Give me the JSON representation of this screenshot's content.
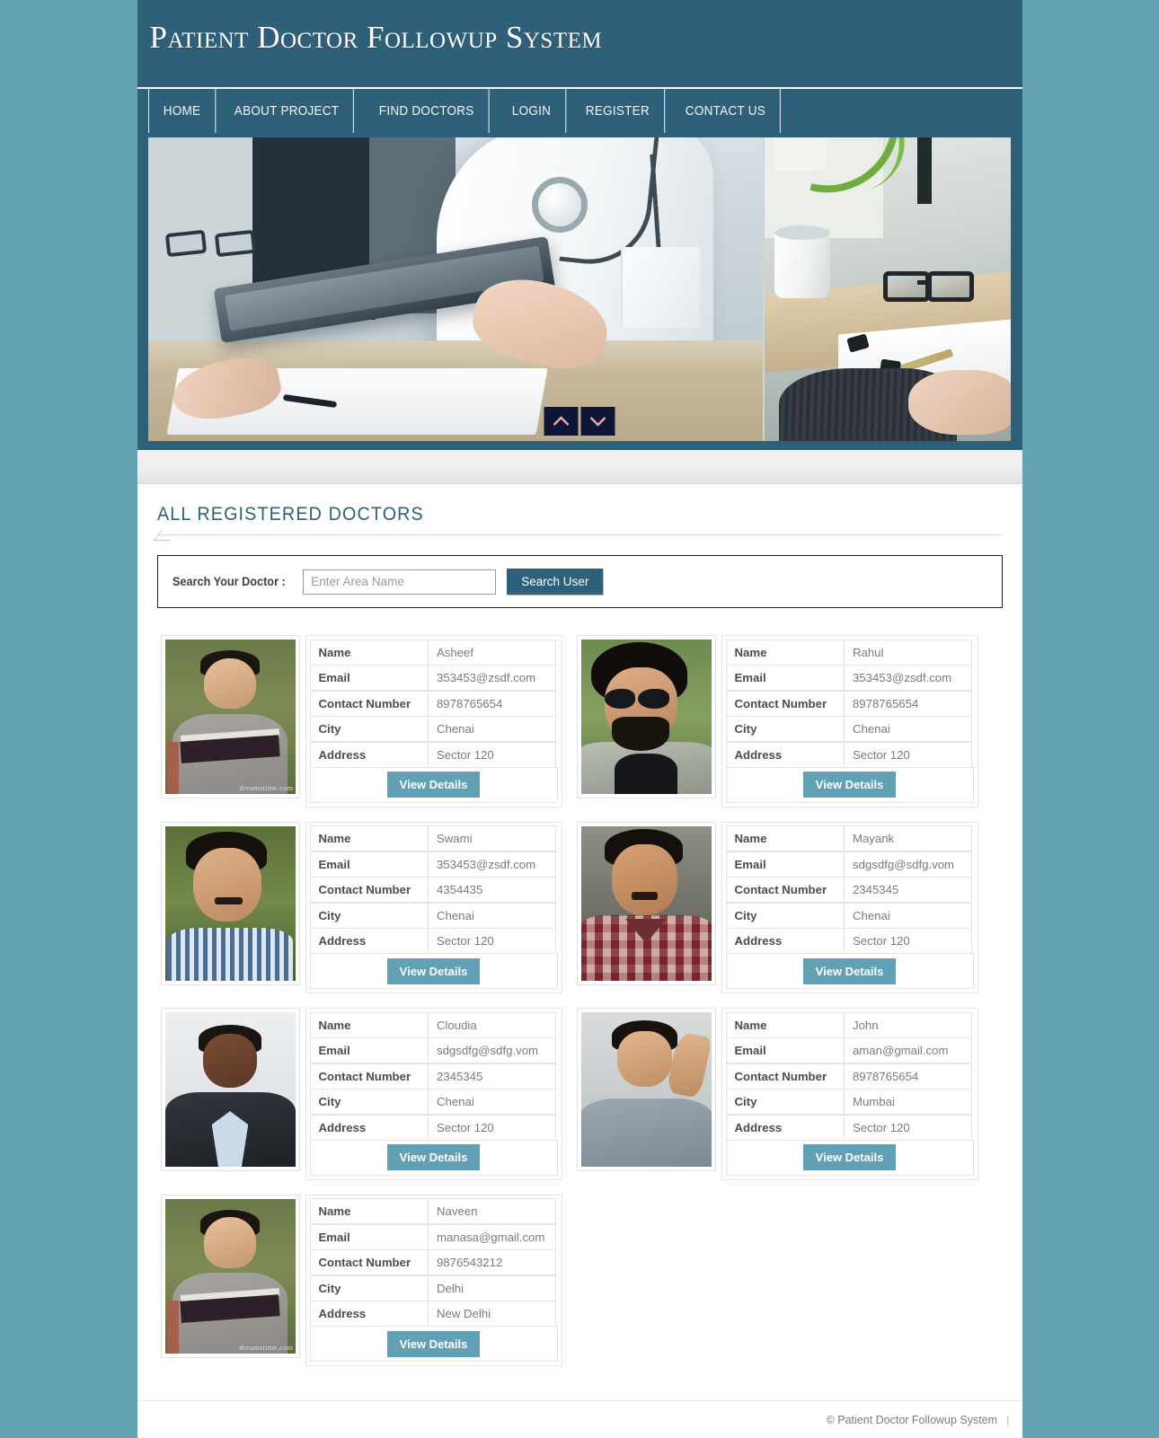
{
  "site": {
    "title": "Patient Doctor Followup System"
  },
  "nav": {
    "items": [
      {
        "label": "HOME"
      },
      {
        "label": "ABOUT PROJECT"
      },
      {
        "label": "FIND DOCTORS"
      },
      {
        "label": "LOGIN"
      },
      {
        "label": "REGISTER"
      },
      {
        "label": "CONTACT US"
      }
    ]
  },
  "slider": {
    "prev_icon": "chevron-up-icon",
    "next_icon": "chevron-down-icon"
  },
  "main": {
    "section_title": "ALL REGISTERED DOCTORS",
    "search": {
      "label": "Search Your Doctor :",
      "placeholder": "Enter Area Name",
      "value": "",
      "button_label": "Search User"
    },
    "fields": {
      "name": "Name",
      "email": "Email",
      "contact": "Contact Number",
      "city": "City",
      "address": "Address"
    },
    "view_details_label": "View Details",
    "doctors": [
      {
        "name": "Asheef",
        "email": "353453@zsdf.com",
        "contact": "8978765654",
        "city": "Chenai",
        "address": "Sector 120",
        "photo_watermark": "dreamstime.com"
      },
      {
        "name": "Rahul",
        "email": "353453@zsdf.com",
        "contact": "8978765654",
        "city": "Chenai",
        "address": "Sector 120",
        "photo_watermark": ""
      },
      {
        "name": "Swami",
        "email": "353453@zsdf.com",
        "contact": "4354435",
        "city": "Chenai",
        "address": "Sector 120",
        "photo_watermark": ""
      },
      {
        "name": "Mayank",
        "email": "sdgsdfg@sdfg.vom",
        "contact": "2345345",
        "city": "Chenai",
        "address": "Sector 120",
        "photo_watermark": ""
      },
      {
        "name": "Cloudia",
        "email": "sdgsdfg@sdfg.vom",
        "contact": "2345345",
        "city": "Chenai",
        "address": "Sector 120",
        "photo_watermark": ""
      },
      {
        "name": "John",
        "email": "aman@gmail.com",
        "contact": "8978765654",
        "city": "Mumbai",
        "address": "Sector 120",
        "photo_watermark": ""
      },
      {
        "name": "Naveen",
        "email": "manasa@gmail.com",
        "contact": "9876543212",
        "city": "Delhi",
        "address": "New Delhi",
        "photo_watermark": "dreamstime.com"
      }
    ]
  },
  "footer": {
    "copyright": "© Patient Doctor Followup System",
    "separator": "|"
  },
  "colors": {
    "page_background": "#63a3b3",
    "header": "#2f6079",
    "accent": "#2f6079",
    "view_button": "#62a0b5",
    "slider_button": "#0e1536"
  }
}
